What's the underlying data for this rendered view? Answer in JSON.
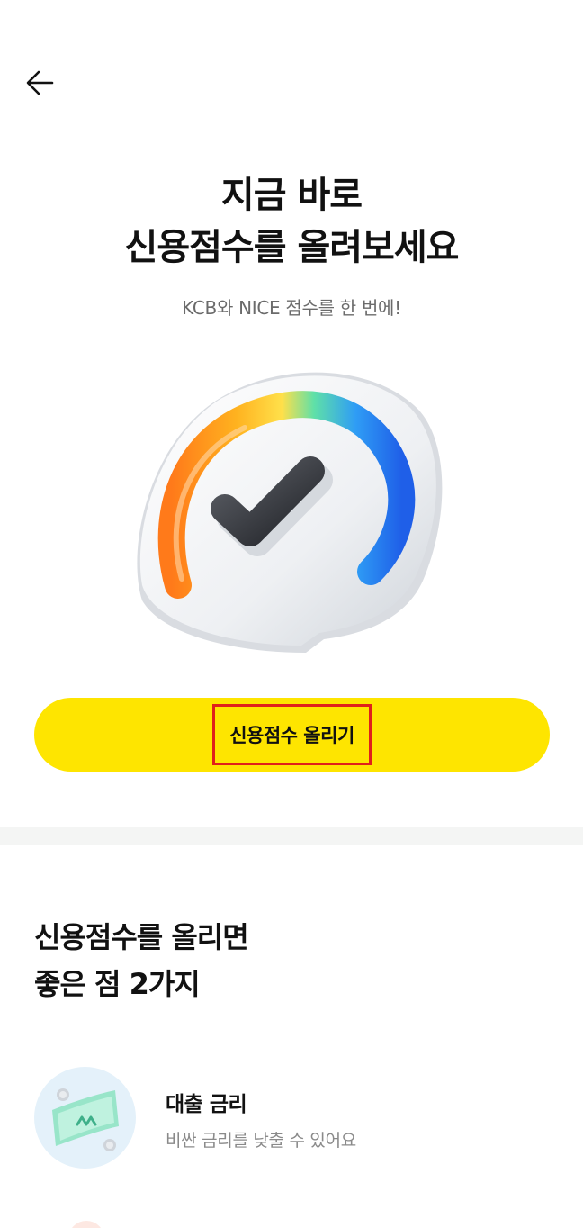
{
  "header": {
    "back_icon": "arrow-left-icon"
  },
  "hero": {
    "title_line1": "지금 바로",
    "title_line2": "신용점수를 올려보세요",
    "subtitle": "KCB와 NICE 점수를 한 번에!",
    "illustration": "credit-score-gauge-checkmark"
  },
  "cta": {
    "label": "신용점수 올리기",
    "color": "#fee500",
    "highlight_color": "#e0201b"
  },
  "benefits": {
    "heading_line1": "신용점수를 올리면",
    "heading_line2": "좋은 점 2가지",
    "items": [
      {
        "icon": "banknote-icon",
        "title": "대출 금리",
        "description": "비싼 금리를 낮출 수 있어요"
      }
    ]
  }
}
